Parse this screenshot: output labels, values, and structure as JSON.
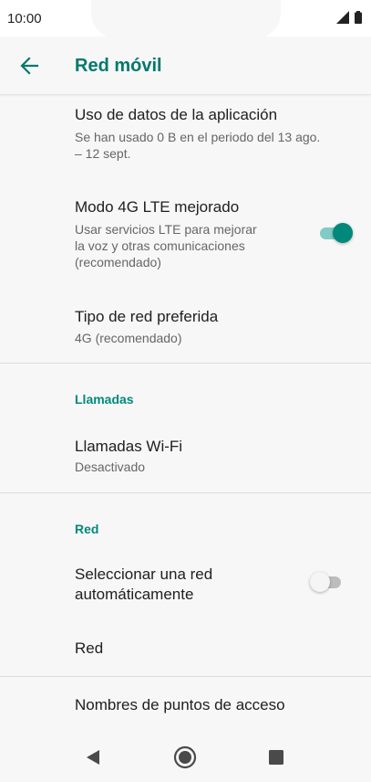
{
  "status_bar": {
    "time": "10:00"
  },
  "app_bar": {
    "title": "Red móvil"
  },
  "items": {
    "data_usage": {
      "title": "Uso de datos de la aplicación",
      "subtitle_line1": "Se han usado 0 B en el periodo del 13 ago.",
      "subtitle_line2": "– 12 sept."
    },
    "lte": {
      "title": "Modo 4G LTE mejorado",
      "subtitle_line1": "Usar servicios LTE para mejorar",
      "subtitle_line2": "la voz y otras comunicaciones",
      "subtitle_line3": "(recomendado)",
      "enabled": true
    },
    "network_type": {
      "title": "Tipo de red preferida",
      "subtitle": "4G (recomendado)"
    },
    "wifi_calling": {
      "title": "Llamadas Wi-Fi",
      "subtitle": "Desactivado"
    },
    "auto_network": {
      "title_line1": "Seleccionar una red",
      "title_line2": "automáticamente",
      "enabled": false
    },
    "network": {
      "title": "Red"
    },
    "apn": {
      "title": "Nombres de puntos de acceso"
    }
  },
  "sections": {
    "calls": "Llamadas",
    "network": "Red"
  },
  "colors": {
    "accent": "#00897b",
    "title": "#00796b"
  }
}
